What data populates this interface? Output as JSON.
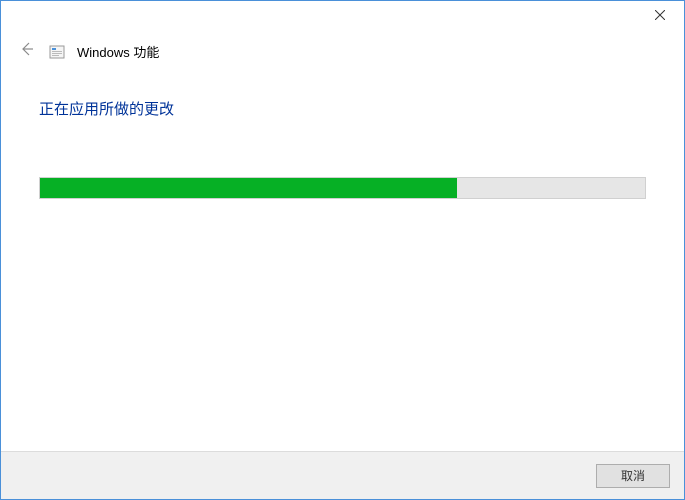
{
  "header": {
    "title": "Windows 功能"
  },
  "content": {
    "heading": "正在应用所做的更改"
  },
  "progress": {
    "percent": 69
  },
  "footer": {
    "cancel_label": "取消"
  }
}
